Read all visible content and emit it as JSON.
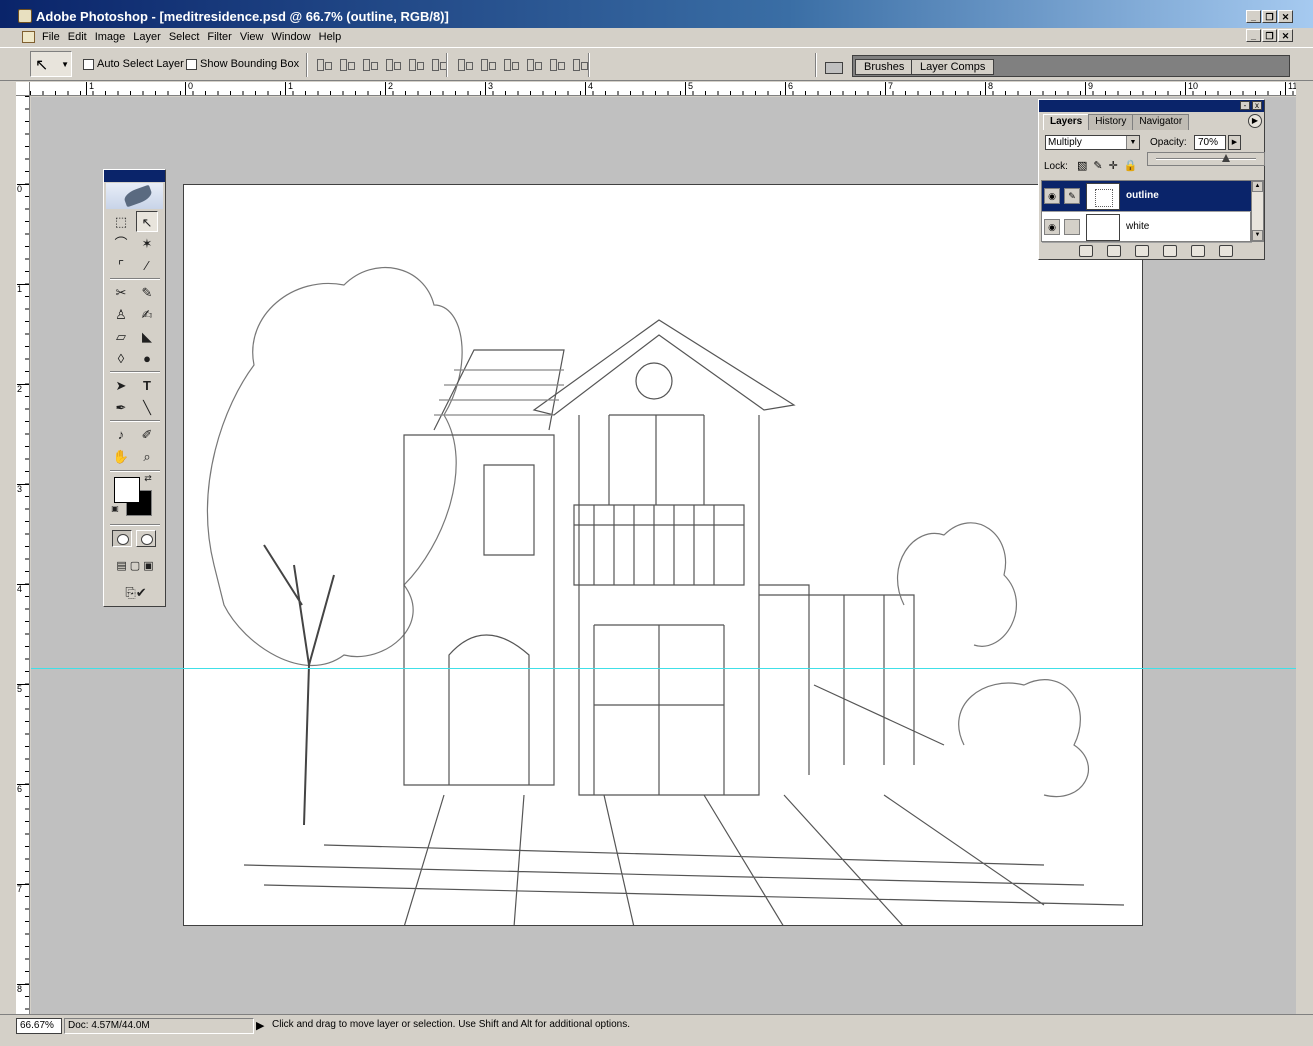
{
  "window": {
    "title": "Adobe Photoshop - [meditresidence.psd @ 66.7% (outline, RGB/8)]",
    "buttons": [
      "_",
      "❐",
      "✕"
    ]
  },
  "menu": {
    "items": [
      "File",
      "Edit",
      "Image",
      "Layer",
      "Select",
      "Filter",
      "View",
      "Window",
      "Help"
    ]
  },
  "options": {
    "auto_select_label": "Auto Select Layer",
    "show_bbox_label": "Show Bounding Box",
    "auto_select_checked": false,
    "show_bbox_checked": false
  },
  "palette_well": {
    "tabs": [
      "Brushes",
      "Layer Comps"
    ]
  },
  "rulers": {
    "horizontal": [
      "1",
      "0",
      "1",
      "2",
      "3",
      "4",
      "5",
      "6",
      "7",
      "8",
      "9",
      "10",
      "11"
    ],
    "vertical": [
      "0",
      "1",
      "2",
      "3",
      "4",
      "5",
      "6",
      "7",
      "8"
    ]
  },
  "layers_panel": {
    "tabs": [
      "Layers",
      "History",
      "Navigator"
    ],
    "blend_mode": "Multiply",
    "opacity_label": "Opacity:",
    "opacity_value": "70%",
    "opacity_fraction": 0.7,
    "lock_label": "Lock:",
    "layers": [
      {
        "name": "outline",
        "active": true,
        "visible": true
      },
      {
        "name": "white",
        "active": false,
        "visible": true
      }
    ]
  },
  "status": {
    "zoom": "66.67%",
    "doc": "Doc: 4.57M/44.0M",
    "message": "Click and drag to move layer or selection.  Use Shift and Alt for additional options."
  },
  "colors": {
    "titlebar_start": "#0a246a",
    "guide": "#40e0e8",
    "selection": "#0a246a"
  }
}
